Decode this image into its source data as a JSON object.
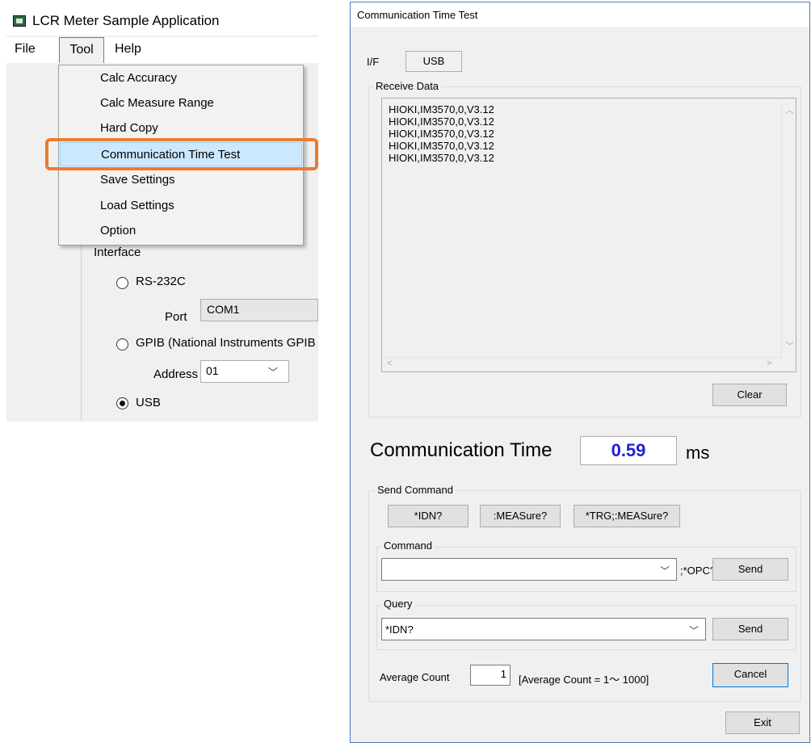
{
  "left_window": {
    "title": "LCR Meter Sample Application",
    "menu": {
      "file": "File",
      "tool": "Tool",
      "help": "Help"
    },
    "tool_menu_items": [
      "Calc Accuracy",
      "Calc Measure Range",
      "Hard Copy",
      "Communication Time Test",
      "Save Settings",
      "Load Settings",
      "Option"
    ],
    "highlighted_item": "Communication Time Test",
    "highlight_color": "#ec7a2e",
    "interface_label": "Interface",
    "rs232c_label": "RS-232C",
    "port_label": "Port",
    "port_value": "COM1",
    "gpib_label": "GPIB (National Instruments GPIB",
    "address_label": "Address",
    "address_value": "01",
    "usb_label": "USB",
    "selected_interface": "USB"
  },
  "dialog": {
    "title": "Communication Time Test",
    "if_label": "I/F",
    "if_value": "USB",
    "receive_data_label": "Receive Data",
    "receive_lines": [
      "HIOKI,IM3570,0,V3.12",
      "HIOKI,IM3570,0,V3.12",
      "HIOKI,IM3570,0,V3.12",
      "HIOKI,IM3570,0,V3.12",
      "HIOKI,IM3570,0,V3.12"
    ],
    "clear_button": "Clear",
    "comm_time_label": "Communication Time",
    "comm_time_value": "0.59",
    "comm_time_unit": "ms",
    "comm_time_color": "#2020d8",
    "send_command_label": "Send Command",
    "quick_buttons": [
      "*IDN?",
      ":MEASure?",
      "*TRG;:MEASure?"
    ],
    "command_group_label": "Command",
    "command_value": "",
    "opc_label": ";*OPC?",
    "command_send": "Send",
    "query_group_label": "Query",
    "query_value": "*IDN?",
    "query_send": "Send",
    "average_count_label": "Average Count",
    "average_count_value": "1",
    "average_range_label": "[Average Count = 1～ 1000]",
    "cancel_button": "Cancel",
    "exit_button": "Exit"
  }
}
